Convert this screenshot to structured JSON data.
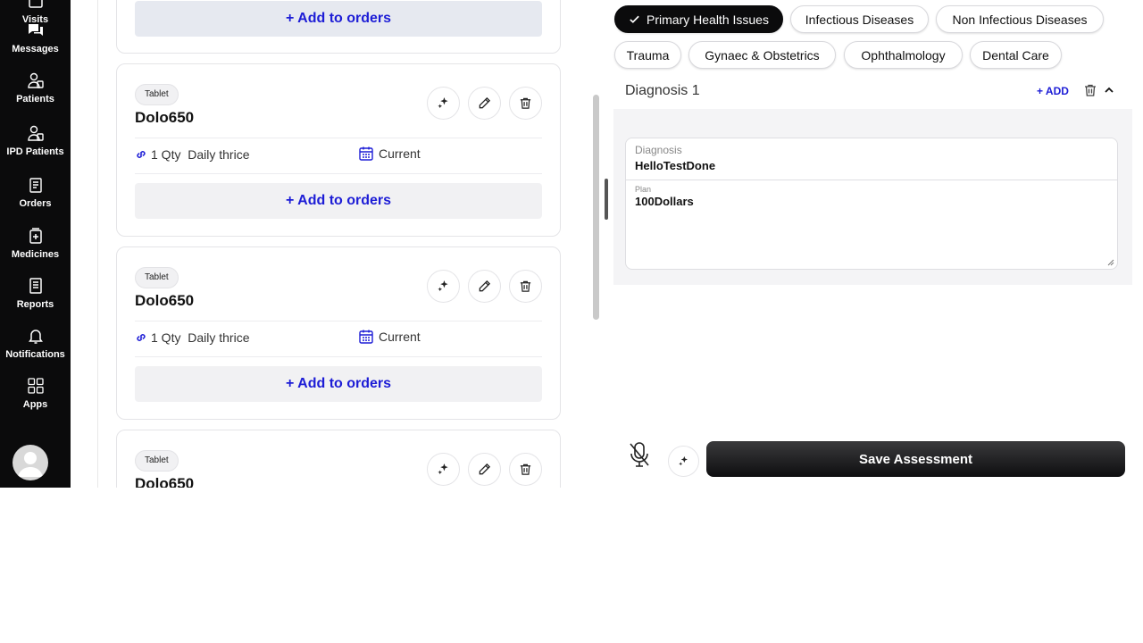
{
  "sidebar": {
    "items": [
      {
        "label": "Visits",
        "icon": "calendar-icon"
      },
      {
        "label": "Messages",
        "icon": "chat-icon"
      },
      {
        "label": "Patients",
        "icon": "patients-icon"
      },
      {
        "label": "IPD Patients",
        "icon": "ipd-patients-icon"
      },
      {
        "label": "Orders",
        "icon": "orders-icon"
      },
      {
        "label": "Medicines",
        "icon": "medicines-icon"
      },
      {
        "label": "Reports",
        "icon": "reports-icon"
      },
      {
        "label": "Notifications",
        "icon": "bell-icon"
      },
      {
        "label": "Apps",
        "icon": "apps-grid-icon"
      }
    ]
  },
  "orders": {
    "first_add_label": "+ Add to orders",
    "cards": [
      {
        "type": "Tablet",
        "name": "Dolo650",
        "dose": "1 Qty  Daily thrice",
        "status": "Current",
        "add_label": "+ Add to orders"
      },
      {
        "type": "Tablet",
        "name": "Dolo650",
        "dose": "1 Qty  Daily thrice",
        "status": "Current",
        "add_label": "+ Add to orders"
      },
      {
        "type": "Tablet",
        "name": "Dolo650"
      }
    ]
  },
  "categories": [
    {
      "label": "Primary Health Issues",
      "active": true
    },
    {
      "label": "Infectious Diseases",
      "active": false
    },
    {
      "label": "Non Infectious Diseases",
      "active": false
    },
    {
      "label": "Trauma",
      "active": false
    },
    {
      "label": "Gynaec & Obstetrics",
      "active": false
    },
    {
      "label": "Ophthalmology",
      "active": false
    },
    {
      "label": "Dental Care",
      "active": false
    }
  ],
  "diagnosis": {
    "title": "Diagnosis 1",
    "add_label": "+ ADD",
    "diagnosis_label": "Diagnosis",
    "diagnosis_value": "HelloTestDone",
    "plan_label": "Plan",
    "plan_value": "100Dollars"
  },
  "footer": {
    "save_label": "Save Assessment"
  },
  "colors": {
    "sidebar_bg": "#0b0b0c",
    "accent_blue": "#1d1dd6",
    "active_chip": "#0b0b0c"
  }
}
